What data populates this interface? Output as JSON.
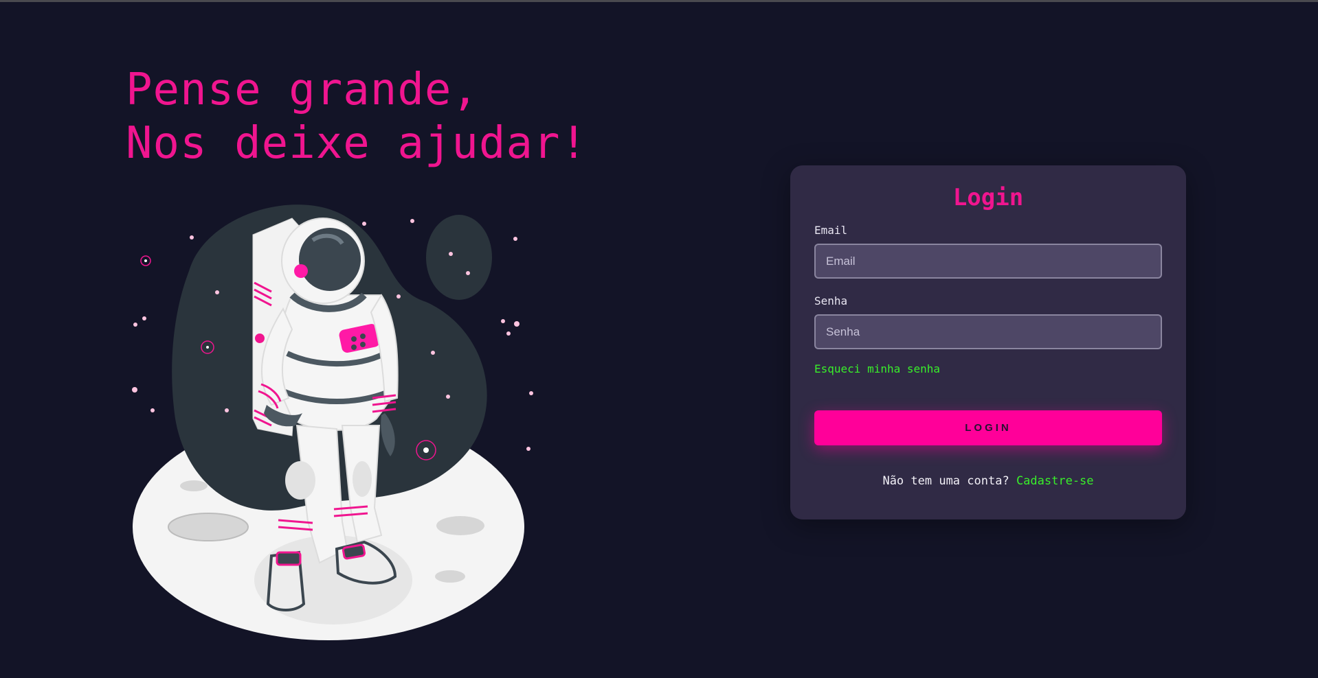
{
  "hero": {
    "line1": "Pense grande,",
    "line2": "Nos deixe ajudar!"
  },
  "illustration": {
    "subject": "astronaut-on-moon"
  },
  "login_card": {
    "title": "Login",
    "email_label": "Email",
    "email_placeholder": "Email",
    "email_value": "",
    "password_label": "Senha",
    "password_placeholder": "Senha",
    "password_value": "",
    "forgot_link": "Esqueci minha senha",
    "submit_label": "LOGIN",
    "no_account_text": "Não tem uma conta?",
    "signup_link": "Cadastre-se"
  },
  "colors": {
    "background": "#131427",
    "accent": "#ff0099",
    "headline": "#f0158f",
    "link": "#39ef2a",
    "card": "#302a45"
  }
}
